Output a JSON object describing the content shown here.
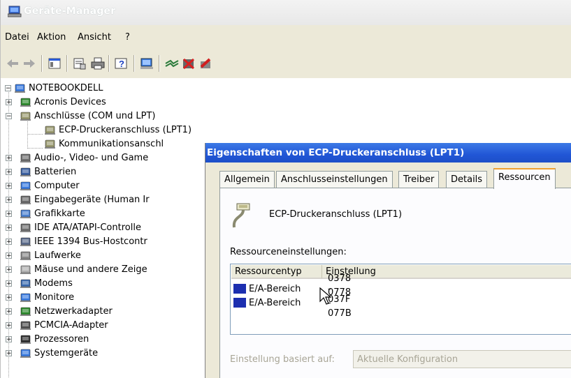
{
  "window": {
    "title": "Geräte-Manager",
    "title_icon": "computer-icon"
  },
  "menu": [
    "Datei",
    "Aktion",
    "Ansicht",
    "?"
  ],
  "toolbar": {
    "buttons": [
      "back-arrow-icon",
      "forward-arrow-icon",
      "console-tree-icon",
      "properties-icon",
      "print-icon",
      "help-icon",
      "scan-hardware-icon",
      "update-driver-icon",
      "uninstall-icon",
      "disable-icon"
    ]
  },
  "tree": {
    "root": "NOTEBOOKDELL",
    "items": [
      {
        "label": "Acronis Devices",
        "icon": "network-card-icon"
      },
      {
        "label": "Anschlüsse (COM und LPT)",
        "icon": "port-icon",
        "expanded": true
      },
      {
        "label": "ECP-Druckeranschluss (LPT1)",
        "icon": "port-icon",
        "child": true
      },
      {
        "label": "Kommunikationsanschl",
        "icon": "port-icon",
        "child": true
      },
      {
        "label": "Audio-, Video- und Game",
        "icon": "sound-icon"
      },
      {
        "label": "Batterien",
        "icon": "battery-icon"
      },
      {
        "label": "Computer",
        "icon": "computer-icon"
      },
      {
        "label": "Eingabegeräte (Human Ir",
        "icon": "input-device-icon"
      },
      {
        "label": "Grafikkarte",
        "icon": "display-adapter-icon"
      },
      {
        "label": "IDE ATA/ATAPI-Controlle",
        "icon": "ide-controller-icon"
      },
      {
        "label": "IEEE 1394 Bus-Hostcontr",
        "icon": "ieee1394-icon"
      },
      {
        "label": "Laufwerke",
        "icon": "disk-drive-icon"
      },
      {
        "label": "Mäuse und andere Zeige",
        "icon": "mouse-icon"
      },
      {
        "label": "Modems",
        "icon": "modem-icon"
      },
      {
        "label": "Monitore",
        "icon": "monitor-icon"
      },
      {
        "label": "Netzwerkadapter",
        "icon": "network-card-icon"
      },
      {
        "label": "PCMCIA-Adapter",
        "icon": "pcmcia-icon"
      },
      {
        "label": "Prozessoren",
        "icon": "processor-icon"
      },
      {
        "label": "Systemgeräte",
        "icon": "system-device-icon"
      }
    ]
  },
  "dialog": {
    "title": "Eigenschaften von ECP-Druckeranschluss (LPT1)",
    "tabs": [
      "Allgemein",
      "Anschlusseinstellungen",
      "Treiber",
      "Details",
      "Ressourcen"
    ],
    "active_tab": "Ressourcen",
    "device_name": "ECP-Druckeranschluss (LPT1)",
    "resources_label": "Ressourceneinstellungen:",
    "columns": [
      "Ressourcentyp",
      "Einstellung"
    ],
    "rows": [
      {
        "type": "E/A-Bereich",
        "value": "0378 - 037F"
      },
      {
        "type": "E/A-Bereich",
        "value": "0778 - 077B"
      }
    ],
    "basis_label": "Einstellung basiert auf:",
    "basis_value": "Aktuelle Konfiguration"
  },
  "colors": {
    "dialog_title": "#2156d6",
    "chip": "#1c2fb0",
    "tab_highlight": "#f0a030"
  }
}
